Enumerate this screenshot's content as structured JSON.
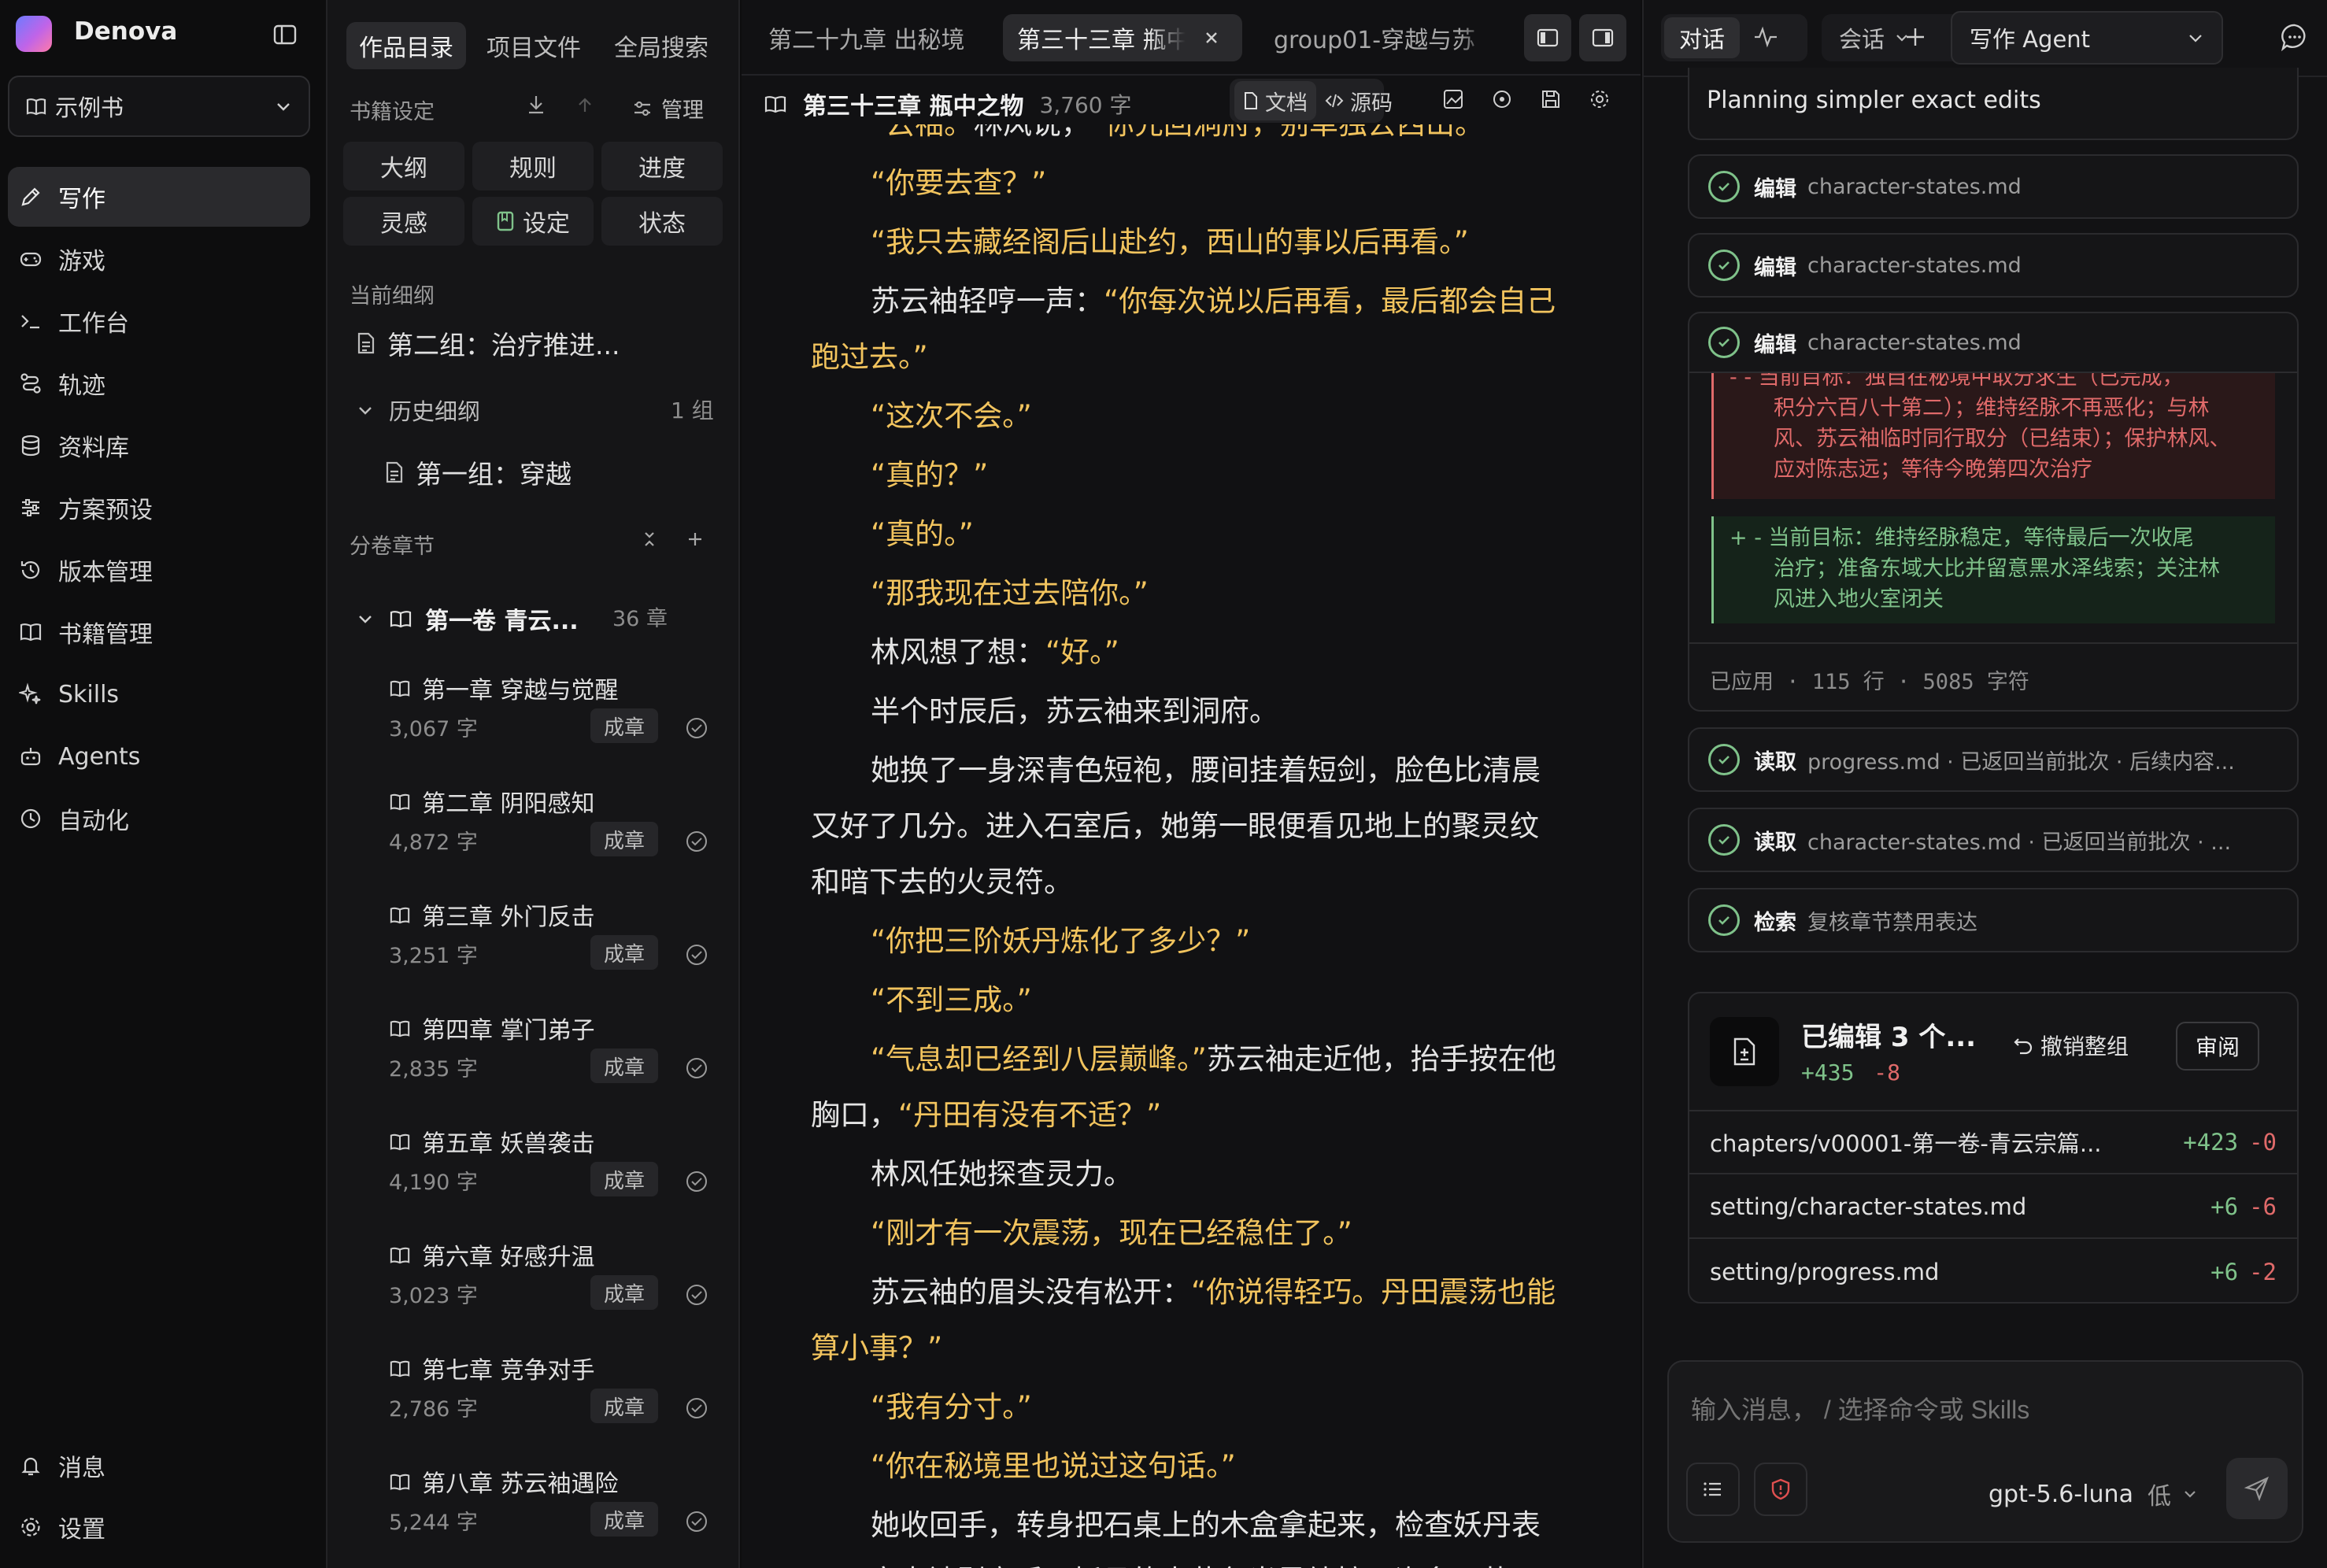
{
  "app": {
    "name": "Denova"
  },
  "book_select": {
    "label": "示例书"
  },
  "nav": {
    "items": [
      {
        "label": "写作",
        "icon": "pen-icon",
        "active": true
      },
      {
        "label": "游戏",
        "icon": "gamepad-icon"
      },
      {
        "label": "工作台",
        "icon": "terminal-icon"
      },
      {
        "label": "轨迹",
        "icon": "route-icon"
      },
      {
        "label": "资料库",
        "icon": "database-icon"
      },
      {
        "label": "方案预设",
        "icon": "sliders-icon"
      },
      {
        "label": "版本管理",
        "icon": "history-icon"
      },
      {
        "label": "书籍管理",
        "icon": "book-icon"
      },
      {
        "label": "Skills",
        "icon": "sparkle-icon"
      },
      {
        "label": "Agents",
        "icon": "robot-icon"
      },
      {
        "label": "自动化",
        "icon": "clock-icon"
      }
    ],
    "bottom": [
      {
        "label": "消息",
        "icon": "bell-icon"
      },
      {
        "label": "设置",
        "icon": "gear-icon"
      }
    ]
  },
  "catalog": {
    "tabs": [
      "作品目录",
      "项目文件",
      "全局搜索"
    ],
    "book_settings_label": "书籍设定",
    "manage_label": "管理",
    "grid": [
      "大纲",
      "规则",
      "进度",
      "灵感",
      "设定",
      "状态"
    ],
    "current_outline_label": "当前细纲",
    "current_outline": "第二组：治疗推进...",
    "history_label": "历史细纲",
    "history_count": "1 组",
    "history_item": "第一组：穿越",
    "volumes_label": "分卷章节",
    "volume": {
      "title": "第一卷 青云...",
      "count": "36 章"
    },
    "chapters": [
      {
        "title": "第一章 穿越与觉醒",
        "words": "3,067 字",
        "status": "成章"
      },
      {
        "title": "第二章 阴阳感知",
        "words": "4,872 字",
        "status": "成章"
      },
      {
        "title": "第三章 外门反击",
        "words": "3,251 字",
        "status": "成章"
      },
      {
        "title": "第四章 掌门弟子",
        "words": "2,835 字",
        "status": "成章"
      },
      {
        "title": "第五章 妖兽袭击",
        "words": "4,190 字",
        "status": "成章"
      },
      {
        "title": "第六章 好感升温",
        "words": "3,023 字",
        "status": "成章"
      },
      {
        "title": "第七章 竞争对手",
        "words": "2,786 字",
        "status": "成章"
      },
      {
        "title": "第八章 苏云袖遇险",
        "words": "5,244 字",
        "status": "成章"
      }
    ]
  },
  "editor": {
    "tabs": [
      {
        "label": "第二十九章 出秘境"
      },
      {
        "label": "第三十三章 瓶中",
        "active": true
      },
      {
        "label": "group01-穿越与苏"
      }
    ],
    "doc_title": "第三十三章 瓶中之物",
    "doc_words": "3,760 字",
    "mode_doc": "文档",
    "mode_source": "源码",
    "paragraphs": [
      [
        {
          "t": "“云袖。”",
          "q": true
        },
        {
          "t": "林风说，"
        },
        {
          "t": "“你先回洞府，别单独去西山。”",
          "q": true
        }
      ],
      [
        {
          "t": "“你要去查？”",
          "q": true
        }
      ],
      [
        {
          "t": "“我只去藏经阁后山赴约，西山的事以后再看。”",
          "q": true
        }
      ],
      [
        {
          "t": "苏云袖轻哼一声："
        },
        {
          "t": "“你每次说以后再看，最后都会自己跑过去。”",
          "q": true
        }
      ],
      [
        {
          "t": "“这次不会。”",
          "q": true
        }
      ],
      [
        {
          "t": "“真的？”",
          "q": true
        }
      ],
      [
        {
          "t": "“真的。”",
          "q": true
        }
      ],
      [
        {
          "t": "“那我现在过去陪你。”",
          "q": true
        }
      ],
      [
        {
          "t": "林风想了想："
        },
        {
          "t": "“好。”",
          "q": true
        }
      ],
      [
        {
          "t": "半个时辰后，苏云袖来到洞府。"
        }
      ],
      [
        {
          "t": "她换了一身深青色短袍，腰间挂着短剑，脸色比清晨又好了几分。进入石室后，她第一眼便看见地上的聚灵纹和暗下去的火灵符。"
        }
      ],
      [
        {
          "t": "“你把三阶妖丹炼化了多少？”",
          "q": true
        }
      ],
      [
        {
          "t": "“不到三成。”",
          "q": true
        }
      ],
      [
        {
          "t": "“气息却已经到八层巅峰。”",
          "q": true
        },
        {
          "t": "苏云袖走近他，抬手按在他胸口，"
        },
        {
          "t": "“丹田有没有不适？”",
          "q": true
        }
      ],
      [
        {
          "t": "林风任她探查灵力。"
        }
      ],
      [
        {
          "t": "“刚才有一次震荡，现在已经稳住了。”",
          "q": true
        }
      ],
      [
        {
          "t": "苏云袖的眉头没有松开："
        },
        {
          "t": "“你说得轻巧。丹田震荡也能算小事？”",
          "q": true
        }
      ],
      [
        {
          "t": "“我有分寸。”",
          "q": true
        }
      ],
      [
        {
          "t": "“你在秘境里也说过这句话。”",
          "q": true
        }
      ],
      [
        {
          "t": "她收回手，转身把石桌上的木盒拿起来，检查妖丹表面。寒毒被剥离后，妖丹的土黄色光晕纯粹了许多。苏云"
        }
      ]
    ]
  },
  "right": {
    "tabs": {
      "chat": "对话",
      "session": "会话",
      "agent": "写作 Agent"
    },
    "planning": "Planning simpler exact edits",
    "edits": [
      {
        "verb": "编辑",
        "obj": "character-states.md"
      },
      {
        "verb": "编辑",
        "obj": "character-states.md"
      },
      {
        "verb": "编辑",
        "obj": "character-states.md"
      }
    ],
    "diff_removed": "- - 当前目标：独自在秘境中取分求生（已完成，积分六百八十第二）；维持经脉不再恶化；与林风、苏云袖临时同行取分（已结束）；保护林风、应对陈志远；等待今晚第四次治疗",
    "diff_removed_lines": [
      "- - 当前目标：独自在秘境中取分求生（已完成，",
      "积分六百八十第二）；维持经脉不再恶化；与林",
      "风、苏云袖临时同行取分（已结束）；保护林风、",
      "应对陈志远；等待今晚第四次治疗"
    ],
    "diff_added_lines": [
      "+ - 当前目标：维持经脉稳定，等待最后一次收尾",
      "治疗；准备东域大比并留意黑水泽线索；关注林",
      "风进入地火室闭关"
    ],
    "applied": "已应用 · 115 行 · 5085 字符",
    "reads": [
      {
        "verb": "读取",
        "obj": "progress.md · 已返回当前批次 · 后续内容..."
      },
      {
        "verb": "读取",
        "obj": "character-states.md · 已返回当前批次 · ..."
      },
      {
        "verb": "检索",
        "obj": "复核章节禁用表达"
      }
    ],
    "summary": {
      "title": "已编辑 3 个...",
      "added": "+435",
      "removed": "-8",
      "undo": "撤销整组",
      "review": "审阅",
      "files": [
        {
          "name": "chapters/v00001-第一卷-青云宗篇...",
          "added": "+423",
          "removed": "-0"
        },
        {
          "name": "setting/character-states.md",
          "added": "+6",
          "removed": "-6"
        },
        {
          "name": "setting/progress.md",
          "added": "+6",
          "removed": "-2"
        }
      ]
    },
    "input_placeholder": "输入消息， / 选择命令或 Skills",
    "model": "gpt-5.6-luna",
    "effort": "低"
  },
  "colors": {
    "accent_quote": "#f2c45e",
    "diff_add": "#7fc28a",
    "diff_remove": "#e06a6a"
  }
}
